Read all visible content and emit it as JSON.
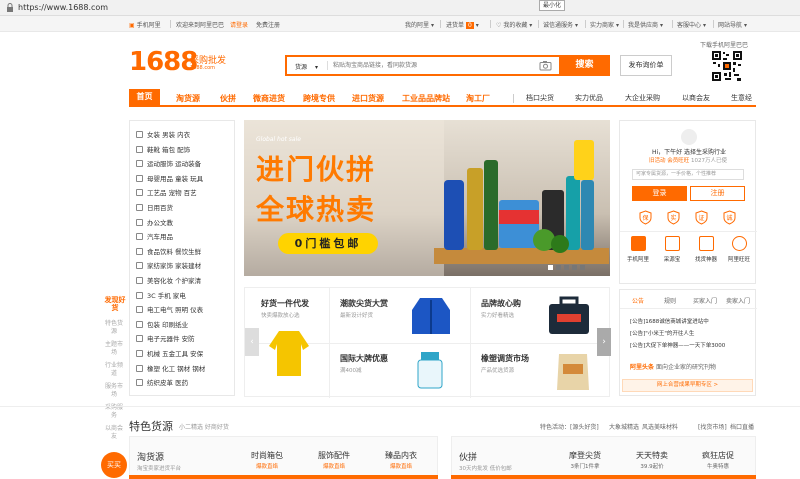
{
  "browser": {
    "url": "https://www.1688.com",
    "tooltip": "最小化"
  },
  "topnav": {
    "phone": "手机阿里",
    "welcome": "欢迎来到阿里巴巴",
    "login": "请登录",
    "register": "免费注册",
    "my_ali": "我的阿里",
    "cart": "进货单",
    "cart_count": "0",
    "favorites": "我的收藏",
    "csr": "诚信通服务",
    "power_merchant": "实力商家",
    "supplier": "我是供应商",
    "support": "客服中心",
    "sitemap": "网站导航"
  },
  "header": {
    "logo_num": "1688",
    "logo_cn": "采购批发",
    "logo_url": "1688.com",
    "search_category": "货源",
    "search_placeholder": "粘贴淘宝商品链接，看同款货源",
    "search_button": "搜索",
    "publish_button": "发布询价单",
    "qr_label": "下载手机阿里巴巴"
  },
  "categories": {
    "home": "首页",
    "primary": [
      "淘货源",
      "伙拼",
      "微商进货",
      "跨境专供",
      "进口货源",
      "工业品品牌站",
      "淘工厂"
    ],
    "secondary": [
      "档口尖货",
      "实力优品",
      "大企业采购",
      "以商会友",
      "生意经"
    ]
  },
  "sidebar": {
    "items": [
      "女装 男装 内衣",
      "鞋靴 箱包 配饰",
      "运动服饰 运动装备",
      "母婴用品 童装 玩具",
      "工艺品 宠物 百艺",
      "日用百货",
      "办公文教",
      "汽车用品",
      "食品饮料 餐饮生鲜",
      "家纺家饰 家装建材",
      "美容化妆 个护家清",
      "3C 手机 家电",
      "电工电气 照明 仪表",
      "包装 印刷纸业",
      "电子元器件 安防",
      "机械 五金工具 安保",
      "橡塑 化工 钢材 钢材",
      "纺织皮革 医药"
    ],
    "discover_label": "发现好货",
    "side_tags": [
      "特色货源",
      "主题市场",
      "行业频道",
      "服务市场",
      "采购服务",
      "以商会友"
    ]
  },
  "banner": {
    "tag": "Global hot sale",
    "headline1": "进门伙拼",
    "headline2": "全球热卖",
    "cta": "0门槛包邮"
  },
  "login_panel": {
    "greeting": "Hi，下午好   选择生采购行业",
    "stats_prefix": "旧活动",
    "stats_highlight": "会员旺旺",
    "stats_text": "1027万人已使",
    "input_hint": "可家专属货源，一手价格，个性推荐",
    "login_button": "登录",
    "register_button": "注册",
    "badges": [
      "保",
      "实",
      "证",
      "诚"
    ],
    "tools": [
      "手机阿里",
      "采源宝",
      "找货神器",
      "阿里旺旺"
    ]
  },
  "notice_panel": {
    "tabs": [
      "公告",
      "规则",
      "买家入门",
      "卖家入门"
    ],
    "lines": [
      "[公告]1688诚信商城讲堂进站中",
      "[公告]\"小米王\"的开往人生",
      "[公告]大促下单神器——一天下单3000"
    ],
    "headline_label": "阿里头条",
    "headline_text": "面向企业家的研究刊物",
    "cooperation": "网上合营成果早期专区 >"
  },
  "grid": {
    "cells": [
      {
        "title": "好货一件代发",
        "sub": "快卖爆款放心选"
      },
      {
        "title": "潮款尖货大赏",
        "sub": "最新设计好货"
      },
      {
        "title": "品牌故心购",
        "sub": "实力好看精选"
      },
      {
        "title": "国际大牌优惠",
        "sub": "满400减"
      },
      {
        "title": "橡塑调货市场",
        "sub": "产品优选货源"
      }
    ]
  },
  "bottom": {
    "section_title": "特色货源",
    "section_sub": "小二精选 好商好货",
    "right_links": [
      "特色活动：[源头好货]",
      "大象城精选",
      "风选美味材料",
      "[找货市场]",
      "档口直播"
    ],
    "hot_tag": "买买",
    "cards": [
      {
        "title": "淘货源",
        "sub": "淘宝卖家进货平台"
      },
      {
        "title": "时尚箱包",
        "sub": "爆款直络"
      },
      {
        "title": "服饰配件",
        "sub": "爆款直络"
      },
      {
        "title": "臻品内衣",
        "sub": "爆款直络"
      },
      {
        "title": "伙拼",
        "sub": "30天内批发 低价包邮"
      },
      {
        "title": "摩登尖货",
        "sub": "3条门1件拿"
      },
      {
        "title": "天天特卖",
        "sub": "39.9起价"
      },
      {
        "title": "疯狂店促",
        "sub": "牛奥特惠"
      }
    ]
  },
  "colors": {
    "brand": "#ff6a00",
    "highlight": "#ffd300"
  }
}
